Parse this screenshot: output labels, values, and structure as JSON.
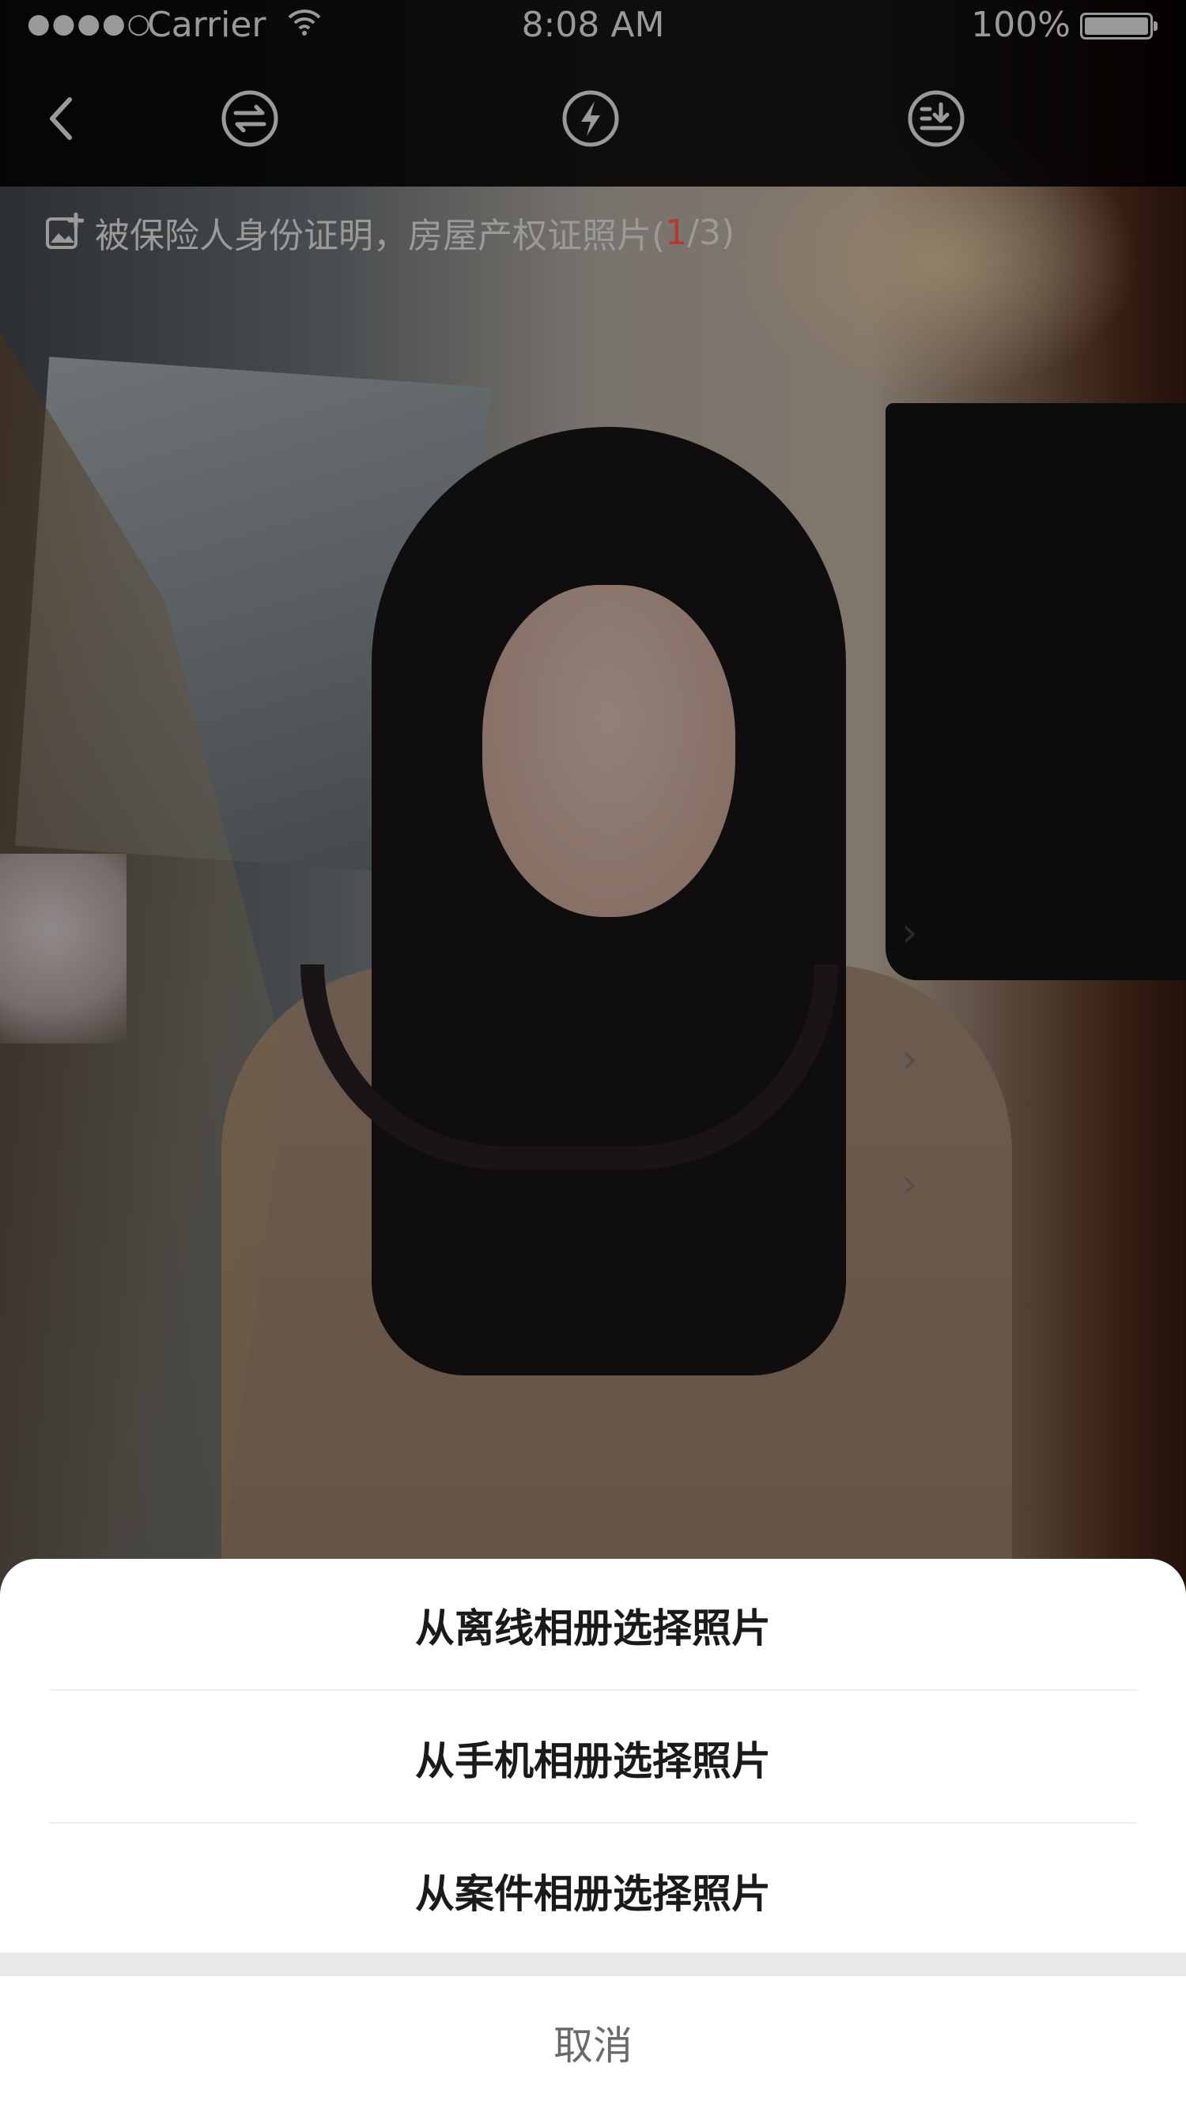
{
  "status_bar": {
    "signal": "●●●●○",
    "carrier": "Carrier",
    "time": "8:08 AM",
    "battery_percent": "100%",
    "wifi_icon": "wifi-icon",
    "battery_icon": "battery-icon"
  },
  "toolbar": {
    "back_icon": "chevron-left-icon",
    "switch_icon": "switch-camera-icon",
    "flash_icon": "flash-icon",
    "mode_icon": "capture-mode-icon",
    "icon_color": "#9a9a9a"
  },
  "caption": {
    "icon": "add-photo-icon",
    "text": "被保险人身份证明，房屋产权证照片(",
    "current": "1",
    "rest": "/3)",
    "current_color": "#b8382e"
  },
  "action_sheet": {
    "options": [
      {
        "label": "从离线相册选择照片"
      },
      {
        "label": "从手机相册选择照片"
      },
      {
        "label": "从案件相册选择照片"
      }
    ],
    "cancel_label": "取消"
  }
}
